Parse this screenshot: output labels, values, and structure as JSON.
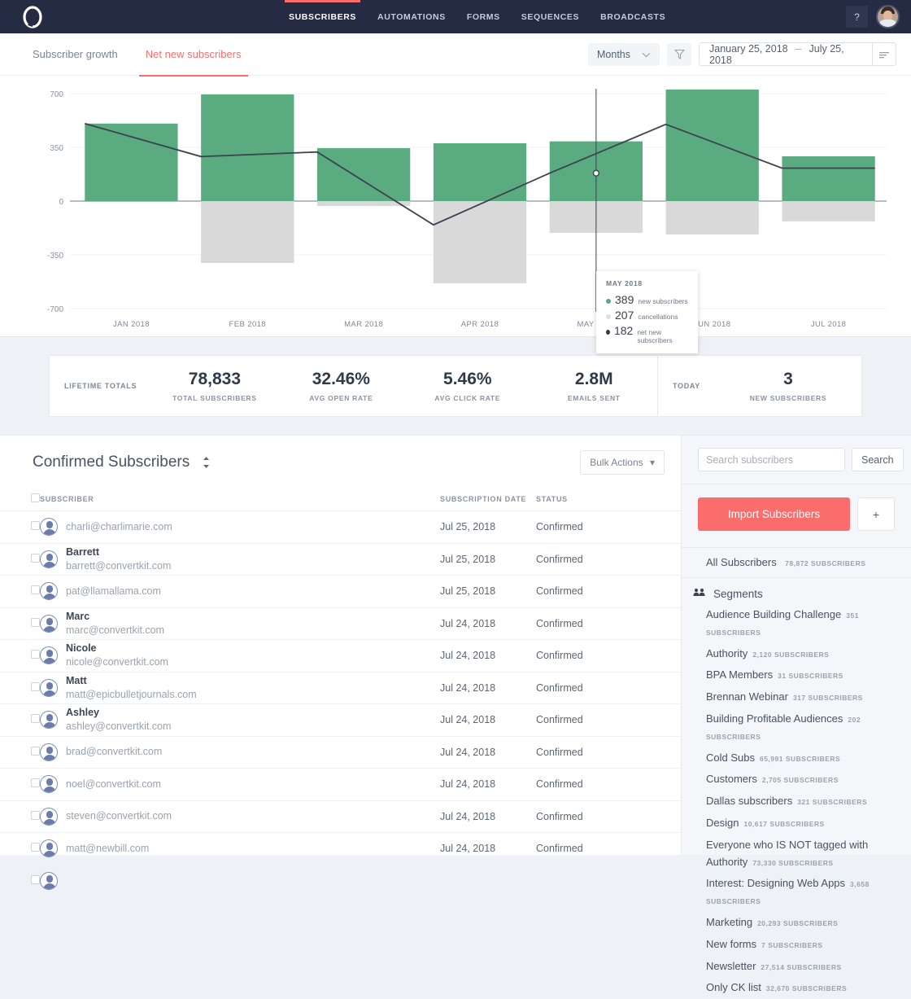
{
  "topnav": {
    "logo_icon": "convertkit-logo-icon",
    "items": [
      {
        "label": "SUBSCRIBERS",
        "active": true
      },
      {
        "label": "AUTOMATIONS",
        "active": false
      },
      {
        "label": "FORMS",
        "active": false
      },
      {
        "label": "SEQUENCES",
        "active": false
      },
      {
        "label": "BROADCASTS",
        "active": false
      }
    ],
    "help_label": "?",
    "avatar_icon": "user-avatar"
  },
  "chart_panel": {
    "tabs": [
      {
        "label": "Subscriber growth",
        "active": false
      },
      {
        "label": "Net new subscribers",
        "active": true
      }
    ],
    "granularity": "Months",
    "granularity_icon": "chevron-down-icon",
    "filter_icon": "funnel-icon",
    "date_start": "January 25, 2018",
    "date_sep": "–",
    "date_end": "July 25, 2018",
    "menu_icon": "list-lines-icon"
  },
  "chart_data": {
    "type": "bar",
    "title": "Net new subscribers",
    "xlabel": "",
    "ylabel": "",
    "ylim": [
      -700,
      700
    ],
    "yticks": [
      700,
      350,
      0,
      -350,
      -700
    ],
    "ytick_labels": [
      "700",
      "350",
      "0",
      "-350",
      "-700"
    ],
    "grid": true,
    "legend_position": "none",
    "categories": [
      "JAN 2018",
      "FEB 2018",
      "MAR 2018",
      "APR 2018",
      "MAY 2018",
      "JUN 2018",
      "JUL 2018"
    ],
    "series": [
      {
        "name": "new subscribers",
        "type": "bar",
        "color": "#5BAB81",
        "values": [
          505,
          695,
          345,
          377,
          389,
          727,
          292
        ]
      },
      {
        "name": "cancellations",
        "type": "bar",
        "color": "#D9D9D9",
        "values": [
          0,
          -403,
          -32,
          -535,
          -207,
          -217,
          -132
        ]
      },
      {
        "name": "net new subscribers",
        "type": "line",
        "color": "#3c4250",
        "values": [
          505,
          290,
          320,
          -155,
          182,
          500,
          215
        ]
      }
    ],
    "hover": {
      "category": "MAY 2018",
      "marker_x_category": "MAY 2018",
      "rows": [
        {
          "value": "389",
          "label": "new subscribers",
          "color": "#5BAB81"
        },
        {
          "value": "207",
          "label": "cancellations",
          "color": "#d8dbdf"
        },
        {
          "value": "182",
          "label": "net new subscribers",
          "color": "#2f3a4a"
        }
      ]
    }
  },
  "stats": {
    "lifetime_label": "LIFETIME TOTALS",
    "today_label": "TODAY",
    "lifetime_cells": [
      {
        "value": "78,833",
        "caption": "TOTAL SUBSCRIBERS"
      },
      {
        "value": "32.46%",
        "caption": "AVG OPEN RATE"
      },
      {
        "value": "5.46%",
        "caption": "AVG CLICK RATE"
      },
      {
        "value": "2.8M",
        "caption": "EMAILS SENT"
      }
    ],
    "today_cells": [
      {
        "value": "3",
        "caption": "NEW SUBSCRIBERS"
      }
    ]
  },
  "subscribers": {
    "title": "Confirmed Subscribers",
    "sort_icon": "sort-updown-icon",
    "bulk_actions_label": "Bulk Actions",
    "bulk_actions_icon": "caret-down-icon",
    "columns": [
      "SUBSCRIBER",
      "SUBSCRIPTION DATE",
      "STATUS"
    ],
    "rows": [
      {
        "name": "",
        "email": "charli@charlimarie.com",
        "date": "Jul 25, 2018",
        "status": "Confirmed"
      },
      {
        "name": "Barrett",
        "email": "barrett@convertkit.com",
        "date": "Jul 25, 2018",
        "status": "Confirmed"
      },
      {
        "name": "",
        "email": "pat@llamallama.com",
        "date": "Jul 25, 2018",
        "status": "Confirmed"
      },
      {
        "name": "Marc",
        "email": "marc@convertkit.com",
        "date": "Jul 24, 2018",
        "status": "Confirmed"
      },
      {
        "name": "Nicole",
        "email": "nicole@convertkit.com",
        "date": "Jul 24, 2018",
        "status": "Confirmed"
      },
      {
        "name": "Matt",
        "email": "matt@epicbulletjournals.com",
        "date": "Jul 24, 2018",
        "status": "Confirmed"
      },
      {
        "name": "Ashley",
        "email": "ashley@convertkit.com",
        "date": "Jul 24, 2018",
        "status": "Confirmed"
      },
      {
        "name": "",
        "email": "brad@convertkit.com",
        "date": "Jul 24, 2018",
        "status": "Confirmed"
      },
      {
        "name": "",
        "email": "noel@convertkit.com",
        "date": "Jul 24, 2018",
        "status": "Confirmed"
      },
      {
        "name": "",
        "email": "steven@convertkit.com",
        "date": "Jul 24, 2018",
        "status": "Confirmed"
      },
      {
        "name": "",
        "email": "matt@newbill.com",
        "date": "Jul 24, 2018",
        "status": "Confirmed"
      },
      {
        "name": "",
        "email": "",
        "date": "",
        "status": ""
      }
    ]
  },
  "sidebar": {
    "search_placeholder": "Search subscribers",
    "search_value": "",
    "search_button": "Search",
    "import_button": "Import Subscribers",
    "add_button": "+",
    "all_subscribers": {
      "name": "All Subscribers",
      "count": "78,872 SUBSCRIBERS"
    },
    "segments_title": "Segments",
    "segments_icon": "users-group-icon",
    "segments": [
      {
        "name": "Audience Building Challenge",
        "count": "351 SUBSCRIBERS"
      },
      {
        "name": "Authority",
        "count": "2,120 SUBSCRIBERS"
      },
      {
        "name": "BPA Members",
        "count": "31 SUBSCRIBERS"
      },
      {
        "name": "Brennan Webinar",
        "count": "317 SUBSCRIBERS"
      },
      {
        "name": "Building Profitable Audiences",
        "count": "202 SUBSCRIBERS"
      },
      {
        "name": "Cold Subs",
        "count": "65,991 SUBSCRIBERS"
      },
      {
        "name": "Customers",
        "count": "2,705 SUBSCRIBERS"
      },
      {
        "name": "Dallas subscribers",
        "count": "321 SUBSCRIBERS"
      },
      {
        "name": "Design",
        "count": "10,617 SUBSCRIBERS"
      },
      {
        "name": "Everyone who IS NOT tagged with Authority",
        "count": "73,330 SUBSCRIBERS"
      },
      {
        "name": "Interest: Designing Web Apps",
        "count": "3,658 SUBSCRIBERS"
      },
      {
        "name": "Marketing",
        "count": "20,293 SUBSCRIBERS"
      },
      {
        "name": "New forms",
        "count": "7 SUBSCRIBERS"
      },
      {
        "name": "Newsletter",
        "count": "27,514 SUBSCRIBERS"
      },
      {
        "name": "Only CK list",
        "count": "32,670 SUBSCRIBERS"
      }
    ]
  },
  "colors": {
    "nav_bg": "#242b42",
    "accent": "#fb6d6d",
    "bar_positive": "#5BAB81",
    "bar_negative": "#D9D9D9",
    "line": "#3c4250",
    "page_bg": "#eef1f5"
  }
}
